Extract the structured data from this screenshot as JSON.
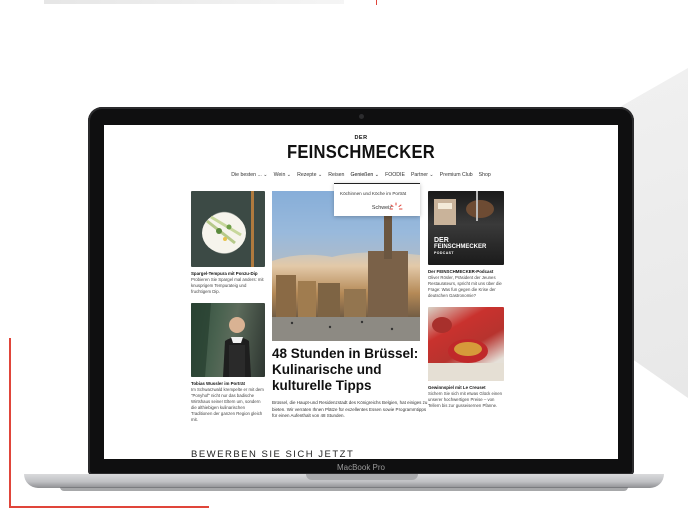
{
  "laptop": {
    "model_label": "MacBook Pro"
  },
  "site": {
    "logo_small": "DER",
    "logo_big": "FEINSCHMECKER",
    "nav": [
      {
        "label": "Die besten ...",
        "chevron": true
      },
      {
        "label": "Wein",
        "chevron": true
      },
      {
        "label": "Rezepte",
        "chevron": true
      },
      {
        "label": "Reisen",
        "chevron": false
      },
      {
        "label": "Genießen",
        "chevron": true
      },
      {
        "label": "FOODIE",
        "chevron": false
      },
      {
        "label": "Partner",
        "chevron": true
      },
      {
        "label": "Premium Club",
        "chevron": false
      },
      {
        "label": "Shop",
        "chevron": false
      }
    ],
    "dropdown": {
      "items": [
        "Köchinnen und Köche im Porträt",
        "Schweiz"
      ]
    },
    "left_articles": [
      {
        "title": "Spargel-Tempura mit Ponzu-Dip",
        "text": "Probieren Sie Spargel mal anders: mit knusprigem Tempurateig und fruchtigem Dip."
      },
      {
        "title": "Tobias Wussler im Porträt",
        "text": "Im Schwarzwald krempelte er mit dem \"Ponyhof\" nicht nur das badische Wirtshaus seiner Eltern um, sondern die althiebigen kulinarischen Traditionen der ganzen Region gleich mit."
      }
    ],
    "hero": {
      "title": "48 Stunden in Brüssel: Kulinarische und kulturelle Tipps",
      "text": "Brüssel, die Haupt-und Residenzstadt des Königreichs Belgien, hat einiges zu bieten. Wir verraten Ihnen Plätze für exzellentes Essen sowie Programmtipps für einen Aufenthalt von 48 Stunden."
    },
    "right_articles": [
      {
        "title": "Der FEINSCHMECKER-Podcast",
        "text": "Oliver Rösler, Präsident der Jeunes Restaurateurs, spricht mit uns über die Frage: Was fun gegen die Krise der deutschen Gastronomie?",
        "overlay": {
          "der": "DER",
          "name": "FEINSCHMECKER",
          "sub": "PODCAST"
        }
      },
      {
        "title": "Gewinnspiel mit Le Creuset",
        "text": "Sichern Sie sich mit etwas Glück einen unserer hochwertigen Preise – von Tellern bis zur gusseisernen Pfanne."
      }
    ],
    "bottom_heading": "BEWERBEN SIE SICH JETZT"
  },
  "colors": {
    "accent": "#e0453a",
    "bezel": "#0f0f10"
  }
}
